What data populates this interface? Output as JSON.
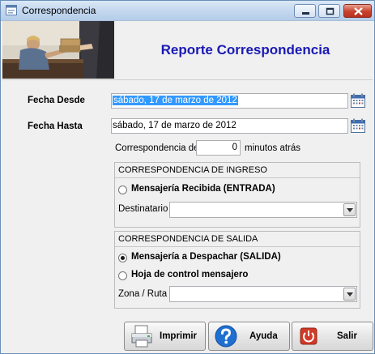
{
  "window": {
    "title": "Correspondencia",
    "icon": "app-form-icon"
  },
  "header": {
    "title": "Reporte Correspondencia",
    "image": "office-mail-handoff-photo"
  },
  "fecha_desde": {
    "label": "Fecha Desde",
    "value": "sábado, 17 de marzo de 2012",
    "selected": true
  },
  "fecha_hasta": {
    "label": "Fecha Hasta",
    "value": "sábado, 17 de marzo de 2012"
  },
  "minutes": {
    "prefix": "Correspondencia de",
    "value": "0",
    "suffix": "minutos atrás"
  },
  "ingreso": {
    "title": "CORRESPONDENCIA DE INGRESO",
    "option": "Mensajería Recibida (ENTRADA)",
    "option_checked": false,
    "recipient_label": "Destinatario",
    "recipient_value": ""
  },
  "salida": {
    "title": "CORRESPONDENCIA DE SALIDA",
    "option1": "Mensajería a Despachar (SALIDA)",
    "option1_checked": true,
    "option2": "Hoja de control mensajero",
    "option2_checked": false,
    "zone_label": "Zona / Ruta",
    "zone_value": ""
  },
  "buttons": {
    "print": "Imprimir",
    "help": "Ayuda",
    "exit": "Salir"
  },
  "colors": {
    "title_blue": "#1a1ab4",
    "selection": "#3399ff",
    "help_blue": "#1f6fd0",
    "exit_red": "#d13a28"
  }
}
